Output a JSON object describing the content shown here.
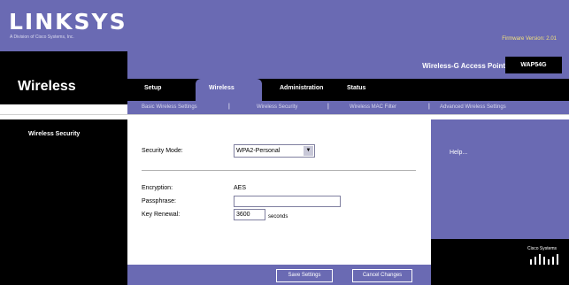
{
  "header": {
    "logo": "LINKSYS",
    "logo_sub": "A Division of Cisco Systems, Inc.",
    "firmware": "Firmware Version: 2.01"
  },
  "section_title": "Wireless",
  "product_name": "Wireless-G Access Point",
  "model": "WAP54G",
  "tabs": {
    "setup": "Setup",
    "wireless": "Wireless",
    "administration": "Administration",
    "status": "Status"
  },
  "subtabs": {
    "basic": "Basic Wireless Settings",
    "security": "Wireless Security",
    "mac_filter": "Wireless MAC Filter",
    "advanced": "Advanced Wireless Settings",
    "separator": "|"
  },
  "left_label": "Wireless Security",
  "form": {
    "security_mode_label": "Security Mode:",
    "security_mode_value": "WPA2-Personal",
    "encryption_label": "Encryption:",
    "encryption_value": "AES",
    "passphrase_label": "Passphrase:",
    "passphrase_value": "",
    "key_renewal_label": "Key Renewal:",
    "key_renewal_value": "3600",
    "key_renewal_unit": "seconds"
  },
  "help": "Help...",
  "buttons": {
    "save": "Save Settings",
    "cancel": "Cancel Changes"
  },
  "footer_logo": "Cisco Systems",
  "colors": {
    "purple": "#6a6ab3",
    "black": "#000000",
    "firmware_yellow": "#f4e27a"
  }
}
